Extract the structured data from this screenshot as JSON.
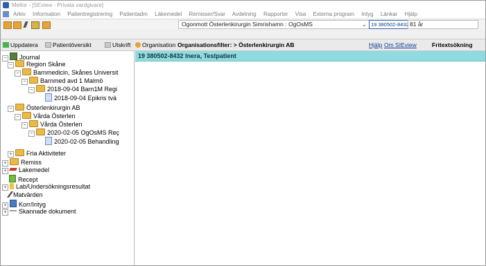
{
  "window": {
    "title": "Meltor - [SEview - Privata vardgivare]"
  },
  "menu": [
    "Arkiv",
    "Information",
    "Patientregistrering",
    "Patientadm",
    "Läkemedel",
    "Remisser/Svar",
    "Avdelning",
    "Rapporter",
    "Visa",
    "Externa program",
    "Intyg",
    "Länkar",
    "Hjälp"
  ],
  "toolbar": {
    "context": "Ogonmott Österlenkirurgin Simrishamn : OgOsMS",
    "personnummer": "19 380502-8432",
    "age": "81 år"
  },
  "linkbar": {
    "uppdatera": "Uppdatera",
    "patientoversikt": "Patientöversikt",
    "utskrift": "Utskrift",
    "organisation": "Organisation",
    "filter": "Organisationsfilter: > Österlenkirurgin AB",
    "hjalp": "Hjälp",
    "om": "Om SIEview",
    "fritext": "Fritextsökning"
  },
  "tree": {
    "journal": "Journal",
    "region_skane": "Region Skåne",
    "barnmedicin": "Barnmedicin, Skånes Universit",
    "barnmed_avd": "Barnmed avd 1 Malmö",
    "contact_2018": "2018-09-04 Barn1M Regi",
    "epikris_2018": "2018-09-04 Epikris tvä",
    "osterlenkirurgin": "Österlenkirurgin AB",
    "varda_osterlen_1": "Vårda Österlen",
    "varda_osterlen_2": "Vårda Österlen",
    "contact_2020": "2020-02-05 OgOsMS Reç",
    "behandling_2020": "2020-02-05 Behandling",
    "fria": "Fria Aktiviteter",
    "remiss": "Remiss",
    "lakemedel": "Lakemedel",
    "recept": "Recept",
    "lab": "Lab/Undersökningsresultat",
    "matvarden": "Matvärden",
    "korr": "Korr/Intyg",
    "skannade": "Skannade dokument"
  },
  "patient_header": "19 380502-8432 Inera, Testpatient"
}
